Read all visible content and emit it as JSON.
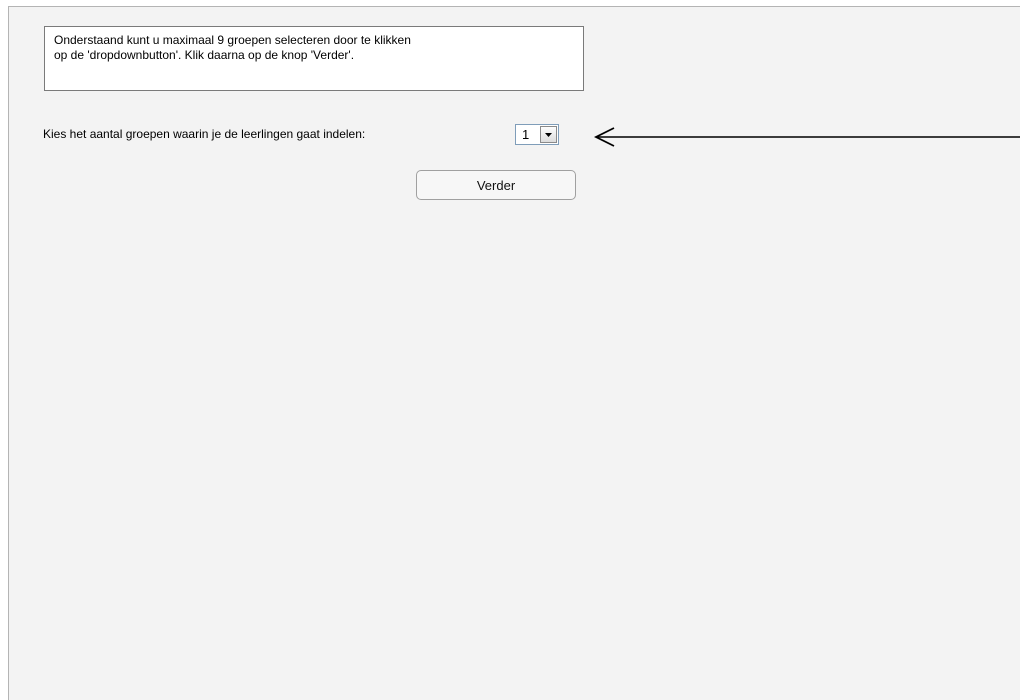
{
  "instructions": {
    "line1": "Onderstaand kunt u maximaal 9 groepen selecteren door te klikken",
    "line2": "op de 'dropdownbutton'. Klik daarna op de knop 'Verder'."
  },
  "group_select": {
    "label": "Kies het aantal groepen waarin je de leerlingen gaat indelen:",
    "selected_value": "1"
  },
  "continue_button": {
    "label": "Verder"
  },
  "icons": {
    "dropdown_arrow": "chevron-down-icon",
    "callout_arrow": "arrow-left-icon"
  },
  "colors": {
    "background": "#f3f3f3",
    "box_background": "#ffffff",
    "arrow": "#000000"
  }
}
